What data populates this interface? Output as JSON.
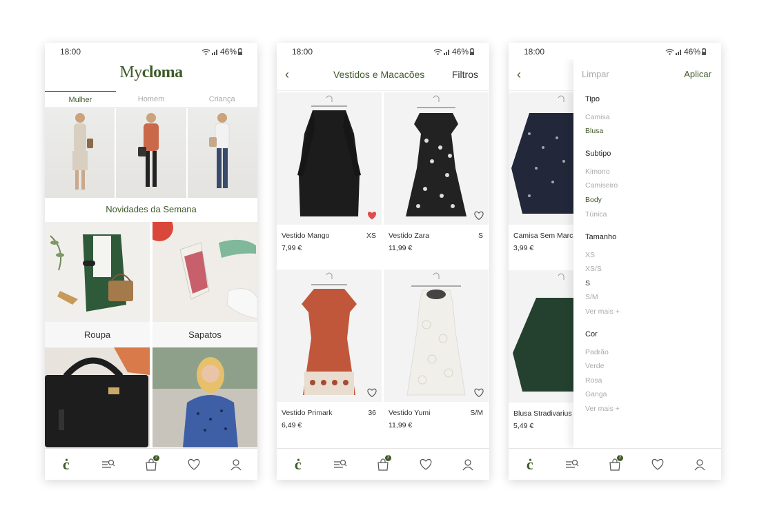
{
  "colors": {
    "brand": "#3f5a2a",
    "heart_fav": "#e04b4b"
  },
  "status": {
    "time": "18:00",
    "battery": "46%"
  },
  "screen1": {
    "logo_light": "My",
    "logo_bold": "cloma",
    "tabs": [
      "Mulher",
      "Homem",
      "Criança"
    ],
    "section_title": "Novidades da Semana",
    "categories": [
      "Roupa",
      "Sapatos"
    ],
    "cart_badge": "2"
  },
  "screen2": {
    "title": "Vestidos e Macacões",
    "filters_label": "Filtros",
    "products": [
      {
        "name": "Vestido Mango",
        "size": "XS",
        "price": "7,99 €",
        "favorite": true
      },
      {
        "name": "Vestido Zara",
        "size": "S",
        "price": "11,99 €",
        "favorite": false
      },
      {
        "name": "Vestido Primark",
        "size": "36",
        "price": "6,49 €",
        "favorite": false
      },
      {
        "name": "Vestido Yumi",
        "size": "S/M",
        "price": "11,99 €",
        "favorite": false
      }
    ],
    "cart_badge": "2"
  },
  "screen3": {
    "clear_label": "Limpar",
    "apply_label": "Aplicar",
    "behind_products": [
      {
        "name": "Camisa Sem Marca",
        "price": "3,99 €"
      },
      {
        "name": "Blusa Stradivarius",
        "price": "5,49 €"
      }
    ],
    "filters": {
      "tipo": {
        "title": "Tipo",
        "options": [
          "Camisa",
          "Blusa"
        ],
        "selected": "Blusa"
      },
      "subtipo": {
        "title": "Subtipo",
        "options": [
          "Kimono",
          "Camiseiro",
          "Body",
          "Túnica"
        ],
        "selected": "Body"
      },
      "tamanho": {
        "title": "Tamanho",
        "options": [
          "XS",
          "XS/S",
          "S",
          "S/M"
        ],
        "selected": "S",
        "more": "Ver mais +"
      },
      "cor": {
        "title": "Cor",
        "options": [
          "Padrão",
          "Verde",
          "Rosa",
          "Ganga"
        ],
        "more": "Ver mais +"
      }
    },
    "cart_badge": "2"
  },
  "icons": [
    "wifi-icon",
    "signal-icon",
    "battery-icon",
    "back-chevron-icon",
    "heart-icon",
    "home-logo-icon",
    "search-list-icon",
    "bag-icon",
    "user-icon"
  ]
}
